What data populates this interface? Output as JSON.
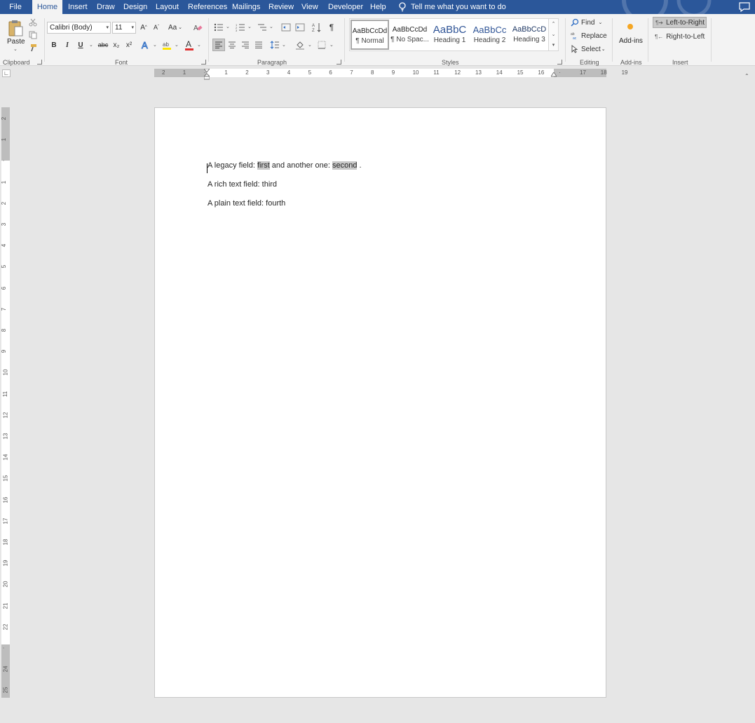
{
  "menu": {
    "tabs": [
      {
        "label": "File"
      },
      {
        "label": "Home"
      },
      {
        "label": "Insert"
      },
      {
        "label": "Draw"
      },
      {
        "label": "Design"
      },
      {
        "label": "Layout"
      },
      {
        "label": "References"
      },
      {
        "label": "Mailings"
      },
      {
        "label": "Review"
      },
      {
        "label": "View"
      },
      {
        "label": "Developer"
      },
      {
        "label": "Help"
      }
    ],
    "active_tab": "Home",
    "tell_me": "Tell me what you want to do",
    "bar_color": "#2b579a"
  },
  "clipboard": {
    "paste_label": "Paste",
    "group_label": "Clipboard"
  },
  "font": {
    "font_name": "Calibri (Body)",
    "font_size": "11",
    "change_case": "Aa",
    "bold": "B",
    "italic": "I",
    "underline": "U",
    "strikethrough": "abc",
    "subscript": "x₂",
    "superscript": "x²",
    "font_color": "A",
    "group_label": "Font"
  },
  "paragraph": {
    "show_marks": "¶",
    "group_label": "Paragraph"
  },
  "styles": {
    "items": [
      {
        "preview": "AaBbCcDd",
        "name": "¶ Normal"
      },
      {
        "preview": "AaBbCcDd",
        "name": "¶ No Spac..."
      },
      {
        "preview": "AaBbC",
        "name": "Heading 1"
      },
      {
        "preview": "AaBbCc",
        "name": "Heading 2"
      },
      {
        "preview": "AaBbCcD",
        "name": "Heading 3"
      }
    ],
    "group_label": "Styles"
  },
  "editing": {
    "find": "Find",
    "replace": "Replace",
    "select": "Select",
    "group_label": "Editing"
  },
  "addins": {
    "label": "Add-ins",
    "group_label": "Add-ins"
  },
  "insert_group": {
    "ltr": "Left-to-Right",
    "rtl": "Right-to-Left",
    "group_label": "Insert"
  },
  "hruler_labels": [
    "2",
    "1",
    "",
    "1",
    "2",
    "3",
    "4",
    "5",
    "6",
    "7",
    "8",
    "9",
    "10",
    "11",
    "12",
    "13",
    "14",
    "15",
    "16",
    "",
    "17",
    "18",
    "19"
  ],
  "vruler_labels": [
    "2",
    "1",
    "",
    "1",
    "2",
    "3",
    "4",
    "5",
    "6",
    "7",
    "8",
    "9",
    "10",
    "11",
    "12",
    "13",
    "14",
    "15",
    "16",
    "17",
    "18",
    "19",
    "20",
    "21",
    "22",
    "",
    "24",
    "25"
  ],
  "document": {
    "line1": {
      "prefix": "A legacy field: ",
      "field1": "first",
      "middle": " and another one: ",
      "field2": "second",
      "suffix": " ."
    },
    "line2": "A rich text field: third",
    "line3": "A plain text field: fourth"
  }
}
